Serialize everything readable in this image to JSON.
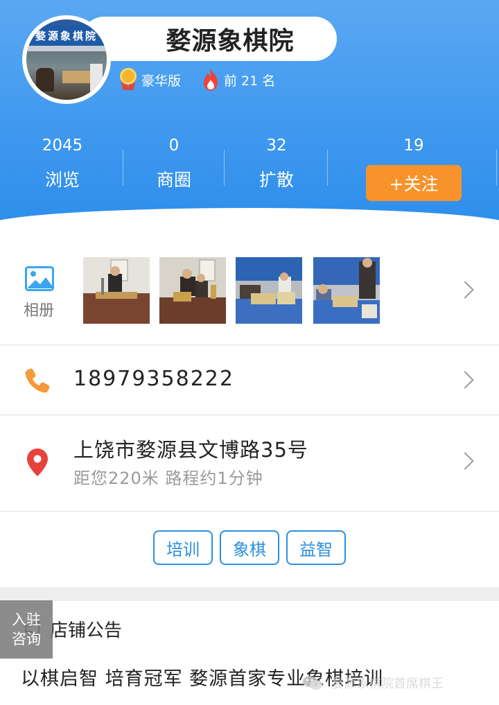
{
  "shop": {
    "name": "婺源象棋院",
    "avatar_sign": "婺源象棋院",
    "badges": [
      {
        "icon": "medal-icon",
        "label": "豪华版"
      },
      {
        "icon": "flame-icon",
        "label": "前 21 名"
      }
    ]
  },
  "stats": [
    {
      "value": "2045",
      "label": "浏览"
    },
    {
      "value": "0",
      "label": "商圈"
    },
    {
      "value": "32",
      "label": "扩散"
    }
  ],
  "follow": {
    "count": "19",
    "label": "+关注"
  },
  "album": {
    "label": "相册",
    "icon": "image-icon",
    "photo_count": 4
  },
  "phone": {
    "icon": "phone-icon",
    "number": "18979358222"
  },
  "address": {
    "icon": "location-pin-icon",
    "street": "上饶市婺源县文博路35号",
    "distance": "距您220米 路程约1分钟"
  },
  "tags": [
    "培训",
    "象棋",
    "益智"
  ],
  "notice": {
    "icon": "megaphone-icon",
    "title": "店铺公告",
    "body": "以棋启智 培育冠军 婺源首家专业象棋培训"
  },
  "consult": {
    "line1": "入驻",
    "line2": "咨询"
  },
  "watermark": {
    "icon": "wechat-icon",
    "text": "婺源象棋院首席棋王"
  },
  "colors": {
    "header": "#3f98ee",
    "follow_button": "#f7932a",
    "tag": "#2b8fe0",
    "phone_icon": "#f39a3b",
    "pin_icon": "#e8413c"
  }
}
